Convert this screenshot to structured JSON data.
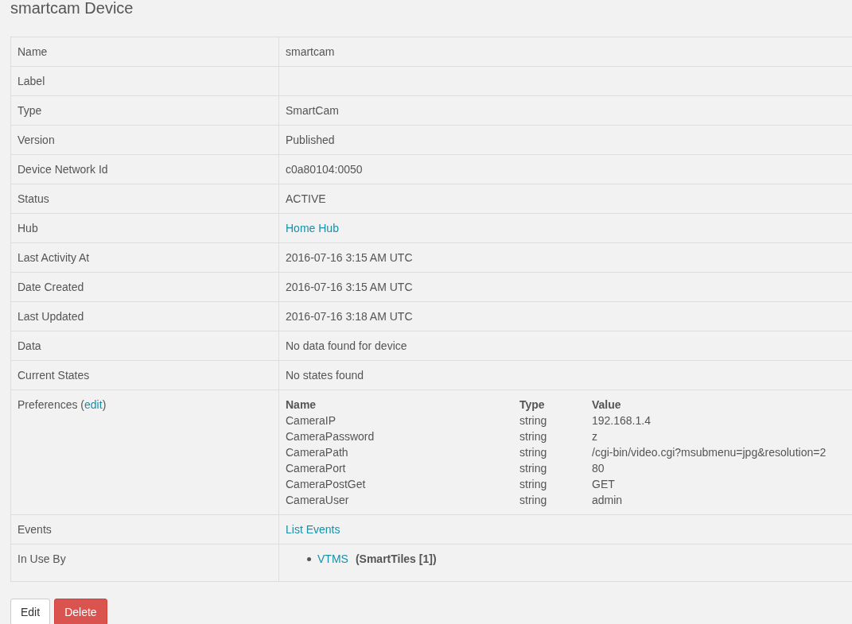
{
  "title": "smartcam Device",
  "rows": [
    {
      "kind": "text",
      "label": "Name",
      "value": "smartcam"
    },
    {
      "kind": "empty",
      "label": "Label"
    },
    {
      "kind": "text",
      "label": "Type",
      "value": "SmartCam"
    },
    {
      "kind": "text",
      "label": "Version",
      "value": "Published"
    },
    {
      "kind": "text",
      "label": "Device Network Id",
      "value": "c0a80104:0050"
    },
    {
      "kind": "text",
      "label": "Status",
      "value": "ACTIVE"
    },
    {
      "kind": "link",
      "label": "Hub",
      "value": "Home Hub"
    },
    {
      "kind": "text",
      "label": "Last Activity At",
      "value": "2016-07-16 3:15 AM UTC"
    },
    {
      "kind": "text",
      "label": "Date Created",
      "value": "2016-07-16 3:15 AM UTC"
    },
    {
      "kind": "text",
      "label": "Last Updated",
      "value": "2016-07-16 3:18 AM UTC"
    },
    {
      "kind": "text",
      "label": "Data",
      "value": "No data found for device"
    },
    {
      "kind": "text",
      "label": "Current States",
      "value": "No states found"
    },
    {
      "kind": "preferences",
      "label": "Preferences (",
      "label_link": "edit",
      "label_after": ")",
      "columns": [
        "Name",
        "Type",
        "Value"
      ],
      "prefs": [
        {
          "name": "CameraIP",
          "type": "string",
          "value": "192.168.1.4"
        },
        {
          "name": "CameraPassword",
          "type": "string",
          "value": "z"
        },
        {
          "name": "CameraPath",
          "type": "string",
          "value": "/cgi-bin/video.cgi?msubmenu=jpg&resolution=2"
        },
        {
          "name": "CameraPort",
          "type": "string",
          "value": "80"
        },
        {
          "name": "CameraPostGet",
          "type": "string",
          "value": "GET"
        },
        {
          "name": "CameraUser",
          "type": "string",
          "value": "admin"
        }
      ]
    },
    {
      "kind": "link",
      "label": "Events",
      "value": "List Events"
    },
    {
      "kind": "in_use",
      "label": "In Use By",
      "items": [
        {
          "name": "VTMS",
          "app": "(SmartTiles [1])"
        }
      ]
    }
  ],
  "buttons": [
    {
      "label": "Edit",
      "kind": "default"
    },
    {
      "label": "Delete",
      "kind": "danger"
    }
  ]
}
